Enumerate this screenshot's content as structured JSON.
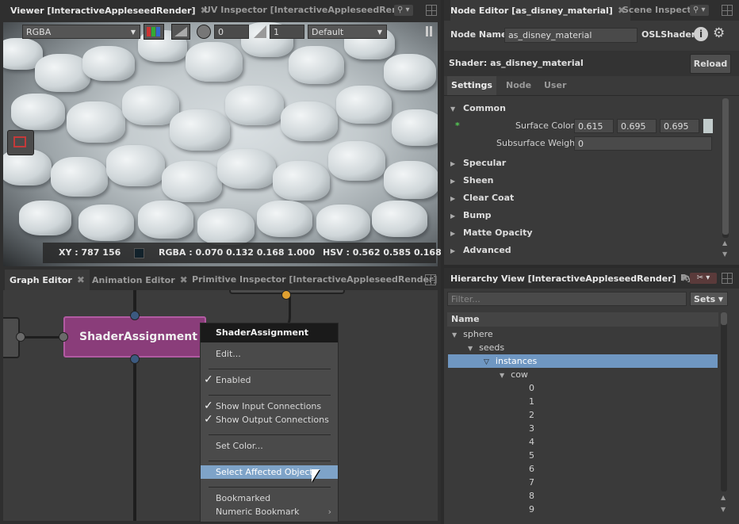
{
  "viewer": {
    "tabs": [
      "Viewer [InteractiveAppleseedRender]",
      "UV Inspector [InteractiveAppleseedRende"
    ],
    "channel": "RGBA",
    "exposure": "0",
    "gamma": "1",
    "display": "Default",
    "status": {
      "xy": "XY : 787 156",
      "rgba": "RGBA : 0.070 0.132 0.168 1.000",
      "hsv": "HSV : 0.562 0.585 0.168"
    }
  },
  "node_editor": {
    "tabs": [
      "Node Editor [as_disney_material]",
      "Scene Inspecto"
    ],
    "node_name_label": "Node Name",
    "node_name": "as_disney_material",
    "type": "OSLShader",
    "shader_label": "Shader: as_disney_material",
    "reload": "Reload",
    "subtabs": [
      "Settings",
      "Node",
      "User"
    ],
    "sections": [
      "Common",
      "Specular",
      "Sheen",
      "Clear Coat",
      "Bump",
      "Matte Opacity",
      "Advanced"
    ],
    "surface_color_label": "Surface Color",
    "surface_color": [
      "0.615",
      "0.695",
      "0.695"
    ],
    "swatch": "#c2cccc",
    "subsurface_label": "Subsurface Weight",
    "subsurface": "0",
    "asterisk": "*"
  },
  "graph": {
    "tabs": [
      "Graph Editor",
      "Animation Editor",
      "Primitive Inspector [InteractiveAppleseedRender]"
    ],
    "node_label": "ShaderAssignment"
  },
  "menu": {
    "title": "ShaderAssignment",
    "items": [
      "Edit...",
      "Enabled",
      "Show Input Connections",
      "Show Output Connections",
      "Set Color...",
      "Select Affected Objects",
      "Bookmarked",
      "Numeric Bookmark"
    ]
  },
  "hierarchy": {
    "tabs": [
      "Hierarchy View [InteractiveAppleseedRender]",
      "Py"
    ],
    "filter_placeholder": "Filter...",
    "sets": "Sets",
    "column": "Name",
    "tree": [
      "sphere",
      "seeds",
      "instances",
      "cow"
    ],
    "indices": [
      "0",
      "1",
      "2",
      "3",
      "4",
      "5",
      "6",
      "7",
      "8",
      "9"
    ]
  }
}
